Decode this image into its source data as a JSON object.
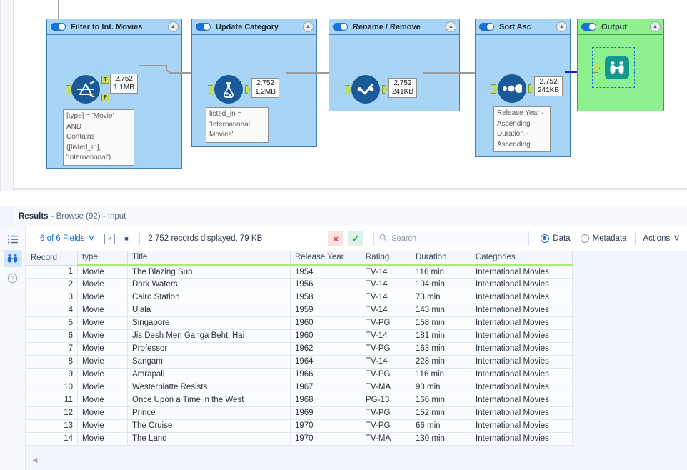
{
  "canvas": {
    "containers": [
      {
        "id": "filter",
        "title": "Filter to Int. Movies",
        "toggle_state": "on",
        "collapse_icon": "collapse-icon",
        "tool_icon": "filter-icon",
        "stats_records": "2,752",
        "stats_size": "1.1MB",
        "anchor_true": "T",
        "anchor_false": "F",
        "annotation": "[type] = 'Movie'\nAND\nContains\n([listed_in],\n'International')"
      },
      {
        "id": "update-category",
        "title": "Update Category",
        "toggle_state": "on",
        "collapse_icon": "collapse-icon",
        "tool_icon": "formula-icon",
        "stats_records": "2,752",
        "stats_size": "1.2MB",
        "annotation": "listed_in =\n'International\nMovies'"
      },
      {
        "id": "rename-remove",
        "title": "Rename / Remove",
        "toggle_state": "on",
        "collapse_icon": "collapse-icon",
        "tool_icon": "select-icon",
        "stats_records": "2,752",
        "stats_size": "241KB",
        "annotation": ""
      },
      {
        "id": "sort-asc",
        "title": "Sort Asc",
        "toggle_state": "on",
        "collapse_icon": "collapse-icon",
        "tool_icon": "sort-icon",
        "stats_records": "2,752",
        "stats_size": "241KB",
        "annotation": "Release Year -\nAscending\nDuration -\nAscending"
      },
      {
        "id": "output",
        "title": "Output",
        "toggle_state": "on",
        "collapse_icon": "collapse-icon",
        "tool_icon": "browse-icon",
        "stats_records": "",
        "stats_size": "",
        "annotation": ""
      }
    ],
    "colors": {
      "container_blue": "#a8d4f5",
      "container_blue_border": "#3f7fbf",
      "container_green": "#8ef08e",
      "container_green_border": "#4a9a4a",
      "tool_blue": "#1a5a96",
      "browse_teal": "#11998e",
      "anchor_green": "#c2dd5c",
      "wire_gray": "#9a9a9a",
      "wire_blue": "#1a1ad4"
    }
  },
  "results": {
    "title_main": "Results",
    "title_sub": "- Browse (92) - Input",
    "sidebar_icons": [
      {
        "name": "list-icon",
        "active": false
      },
      {
        "name": "browse-icon",
        "active": true
      },
      {
        "name": "help-icon",
        "active": false
      }
    ],
    "toolbar": {
      "fields_label": "6 of 6 Fields",
      "chevron": "⌄",
      "select_all_icon": "select-all-checkbox-icon",
      "deselect_all_icon": "deselect-all-icon",
      "records_text": "2,752 records displayed, 79 KB",
      "cancel_label": "×",
      "confirm_label": "✓",
      "search_placeholder": "Search",
      "search_value": "",
      "search_icon": "search-icon",
      "data_label": "Data",
      "metadata_label": "Metadata",
      "selected_view": "Data",
      "actions_label": "Actions",
      "actions_chevron": "⌄"
    },
    "table": {
      "columns": [
        "Record",
        "type",
        "Title",
        "Release Year",
        "Rating",
        "Duration",
        "Categories"
      ],
      "rows": [
        [
          "1",
          "Movie",
          "The Blazing Sun",
          "1954",
          "TV-14",
          "116 min",
          "International Movies"
        ],
        [
          "2",
          "Movie",
          "Dark Waters",
          "1956",
          "TV-14",
          "104 min",
          "International Movies"
        ],
        [
          "3",
          "Movie",
          "Cairo Station",
          "1958",
          "TV-14",
          "73 min",
          "International Movies"
        ],
        [
          "4",
          "Movie",
          "Ujala",
          "1959",
          "TV-14",
          "143 min",
          "International Movies"
        ],
        [
          "5",
          "Movie",
          "Singapore",
          "1960",
          "TV-PG",
          "158 min",
          "International Movies"
        ],
        [
          "6",
          "Movie",
          "Jis Desh Men Ganga Behti Hai",
          "1960",
          "TV-14",
          "181 min",
          "International Movies"
        ],
        [
          "7",
          "Movie",
          "Professor",
          "1962",
          "TV-PG",
          "163 min",
          "International Movies"
        ],
        [
          "8",
          "Movie",
          "Sangam",
          "1964",
          "TV-14",
          "228 min",
          "International Movies"
        ],
        [
          "9",
          "Movie",
          "Amrapali",
          "1966",
          "TV-PG",
          "116 min",
          "International Movies"
        ],
        [
          "10",
          "Movie",
          "Westerplatte Resists",
          "1967",
          "TV-MA",
          "93 min",
          "International Movies"
        ],
        [
          "11",
          "Movie",
          "Once Upon a Time in the West",
          "1968",
          "PG-13",
          "166 min",
          "International Movies"
        ],
        [
          "12",
          "Movie",
          "Prince",
          "1969",
          "TV-PG",
          "152 min",
          "International Movies"
        ],
        [
          "13",
          "Movie",
          "The Cruise",
          "1970",
          "TV-PG",
          "66 min",
          "International Movies"
        ],
        [
          "14",
          "Movie",
          "The Land",
          "1970",
          "TV-MA",
          "130 min",
          "International Movies"
        ]
      ]
    },
    "scroll_left_arrow": "◀"
  }
}
